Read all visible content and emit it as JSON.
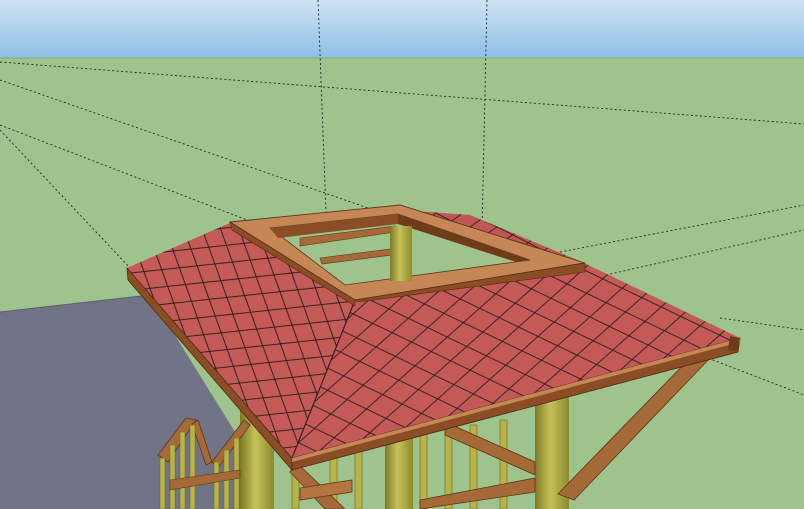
{
  "app": {
    "kind": "3d-modeling-viewport"
  },
  "scene": {
    "colors": {
      "sky_top": "#cfe3f4",
      "sky_bottom": "#8fbfe6",
      "ground": "#9ec38c",
      "pavement": "#707486",
      "roof_tiles": "#c35a58",
      "roof_tile_lines": "#2a1a1a",
      "fascia": "#8a4d25",
      "fascia_top": "#c48755",
      "timber": "#a66a38",
      "post": "#9c9a33",
      "post_highlight": "#c6c25a",
      "guide_lines": "#222222"
    },
    "objects": [
      "sky",
      "ground-plane",
      "pavement-slab",
      "hip-roof",
      "roof-opening-frame",
      "support-posts",
      "diagonal-brace",
      "stair-railing",
      "guide-lines"
    ]
  }
}
